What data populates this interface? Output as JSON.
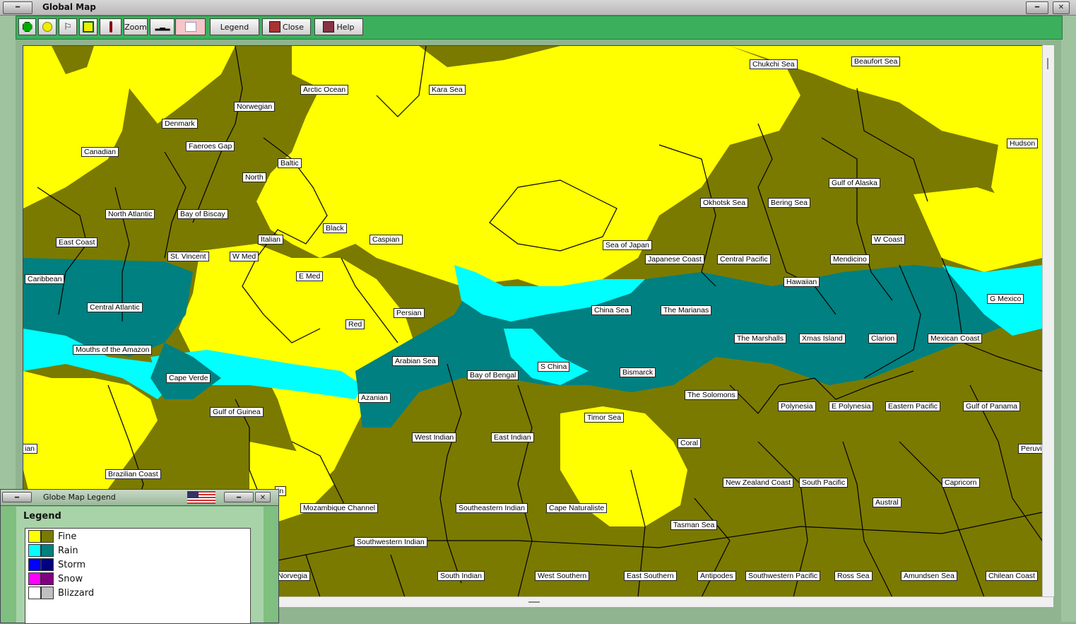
{
  "window": {
    "title": "Global Map"
  },
  "toolbar": {
    "zoom_label": "Zoom",
    "legend_label": "Legend",
    "close_label": "Close",
    "help_label": "Help"
  },
  "legend_window": {
    "title": "Globe Map Legend",
    "heading": "Legend",
    "items": [
      {
        "label": "Fine",
        "colors": [
          "#ffff00",
          "#7a7a00"
        ]
      },
      {
        "label": "Rain",
        "colors": [
          "#00ffff",
          "#008080"
        ]
      },
      {
        "label": "Storm",
        "colors": [
          "#0000ff",
          "#000080"
        ]
      },
      {
        "label": "Snow",
        "colors": [
          "#ff00ff",
          "#800080"
        ]
      },
      {
        "label": "Blizzard",
        "colors": [
          "#ffffff",
          "#c0c0c0"
        ]
      }
    ]
  },
  "regions": [
    "Chukchi Sea",
    "Beaufort Sea",
    "Arctic Ocean",
    "Kara Sea",
    "Norwegian",
    "Denmark",
    "Canadian",
    "Faeroes Gap",
    "Baltic",
    "North",
    "Hudson",
    "Gulf of Alaska",
    "Okhotsk Sea",
    "Bering Sea",
    "North Atlantic",
    "Bay of Biscay",
    "Black",
    "Caspian",
    "Italian",
    "East Coast",
    "Sea of Japan",
    "W Coast",
    "St. Vincent",
    "W Med",
    "Japanese Coast",
    "Central Pacific",
    "Mendicino",
    "E Med",
    "Caribbean",
    "Hawaiian",
    "G Mexico",
    "Central Atlantic",
    "China Sea",
    "The Marianas",
    "Persian",
    "Red",
    "The Marshalls",
    "Xmas Island",
    "Clarion",
    "Mexican Coast",
    "Mouths of the Amazon",
    "Arabian Sea",
    "S China",
    "Bismarck",
    "Cape Verde",
    "Bay of Bengal",
    "The Solomons",
    "Azanian",
    "Polynesia",
    "E Polynesia",
    "Eastern Pacific",
    "Gulf of Panama",
    "Gulf of Guinea",
    "Timor Sea",
    "West Indian",
    "East Indian",
    "Coral",
    "ian",
    "Peruvi",
    "Brazilian Coast",
    "New Zealand Coast",
    "South Pacific",
    "Capricorn",
    "in",
    "Austral",
    "Mozambique Channel",
    "Southeastern Indian",
    "Cape Naturaliste",
    "Tasman Sea",
    "Southwestern Indian",
    "Norvegia",
    "South Indian",
    "West Southern",
    "East Southern",
    "Antipodes",
    "Southwestern Pacific",
    "Ross Sea",
    "Amundsen Sea",
    "Chilean Coast"
  ]
}
